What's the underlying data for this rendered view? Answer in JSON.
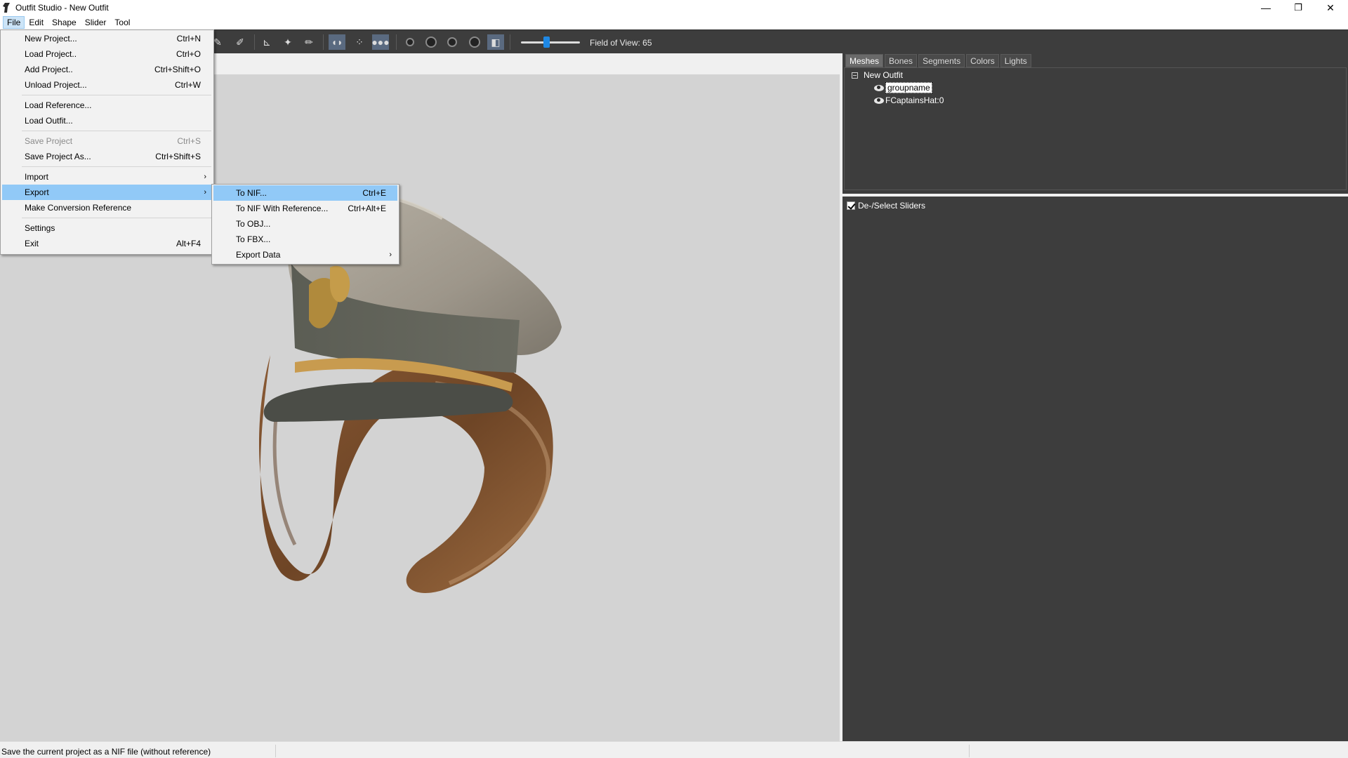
{
  "window": {
    "title": "Outfit Studio - New Outfit",
    "controls": {
      "minimize": "—",
      "maximize": "❐",
      "close": "✕"
    }
  },
  "menubar": {
    "items": [
      "File",
      "Edit",
      "Shape",
      "Slider",
      "Tool"
    ],
    "active": "File"
  },
  "toolbar": {
    "fov_label": "Field of View: 65",
    "fov_value": 65
  },
  "file_menu": {
    "items": [
      {
        "label": "New Project...",
        "accel": "Ctrl+N"
      },
      {
        "label": "Load Project..",
        "accel": "Ctrl+O"
      },
      {
        "label": "Add Project..",
        "accel": "Ctrl+Shift+O"
      },
      {
        "label": "Unload Project...",
        "accel": "Ctrl+W"
      },
      {
        "label": "Load Reference...",
        "accel": ""
      },
      {
        "label": "Load Outfit...",
        "accel": ""
      },
      {
        "label": "Save Project",
        "accel": "Ctrl+S",
        "disabled": true
      },
      {
        "label": "Save Project As...",
        "accel": "Ctrl+Shift+S"
      },
      {
        "label": "Import",
        "accel": "",
        "submenu": true
      },
      {
        "label": "Export",
        "accel": "",
        "submenu": true,
        "highlighted": true
      },
      {
        "label": "Make Conversion Reference",
        "accel": ""
      },
      {
        "label": "Settings",
        "accel": ""
      },
      {
        "label": "Exit",
        "accel": "Alt+F4"
      }
    ]
  },
  "export_menu": {
    "items": [
      {
        "label": "To NIF...",
        "accel": "Ctrl+E",
        "highlighted": true
      },
      {
        "label": "To NIF With Reference...",
        "accel": "Ctrl+Alt+E"
      },
      {
        "label": "To OBJ...",
        "accel": ""
      },
      {
        "label": "To FBX...",
        "accel": ""
      },
      {
        "label": "Export Data",
        "accel": "",
        "submenu": true
      }
    ]
  },
  "right_panel": {
    "tabs": [
      "Meshes",
      "Bones",
      "Segments",
      "Colors",
      "Lights"
    ],
    "active_tab": "Meshes",
    "tree": {
      "root": "New Outfit",
      "children": [
        "groupname",
        "FCaptainsHat:0"
      ],
      "selected": "groupname"
    },
    "sliders_header": "De-/Select Sliders",
    "sliders_checked": true
  },
  "statusbar": {
    "text": "Save the current project as a NIF file (without reference)"
  }
}
